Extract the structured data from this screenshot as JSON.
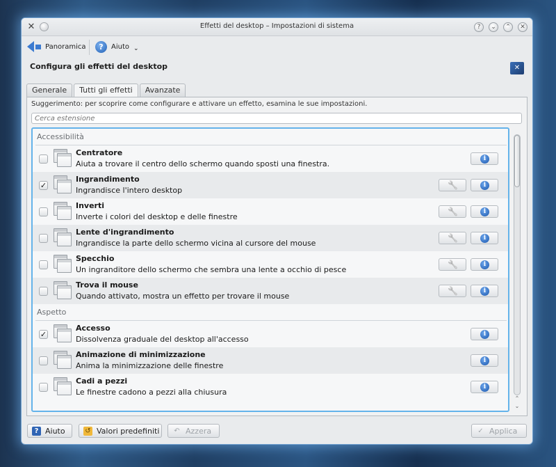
{
  "window": {
    "title": "Effetti del desktop – Impostazioni di sistema"
  },
  "toolbar": {
    "overview_label": "Panoramica",
    "help_label": "Aiuto"
  },
  "page": {
    "header": "Configura gli effetti del desktop"
  },
  "tabs": [
    {
      "label": "Generale",
      "active": false
    },
    {
      "label": "Tutti gli effetti",
      "active": true
    },
    {
      "label": "Avanzate",
      "active": false
    }
  ],
  "hint": "Suggerimento: per scoprire come configurare e attivare un effetto, esamina le sue impostazioni.",
  "search": {
    "placeholder": "Cerca estensione"
  },
  "categories": [
    {
      "name": "Accessibilità",
      "effects": [
        {
          "name": "Centratore",
          "desc": "Aiuta a trovare il centro dello schermo quando sposti una finestra.",
          "checked": false,
          "configurable": false
        },
        {
          "name": "Ingrandimento",
          "desc": "Ingrandisce l'intero desktop",
          "checked": true,
          "configurable": true
        },
        {
          "name": "Inverti",
          "desc": "Inverte i colori del desktop e delle finestre",
          "checked": false,
          "configurable": true
        },
        {
          "name": "Lente d'ingrandimento",
          "desc": "Ingrandisce la parte dello schermo vicina al cursore del mouse",
          "checked": false,
          "configurable": true
        },
        {
          "name": "Specchio",
          "desc": "Un ingranditore dello schermo che sembra una lente a occhio di pesce",
          "checked": false,
          "configurable": true
        },
        {
          "name": "Trova il mouse",
          "desc": "Quando attivato, mostra un effetto per trovare il mouse",
          "checked": false,
          "configurable": true
        }
      ]
    },
    {
      "name": "Aspetto",
      "effects": [
        {
          "name": "Accesso",
          "desc": "Dissolvenza graduale del desktop all'accesso",
          "checked": true,
          "configurable": false
        },
        {
          "name": "Animazione di minimizzazione",
          "desc": "Anima la minimizzazione delle finestre",
          "checked": false,
          "configurable": false
        },
        {
          "name": "Cadi a pezzi",
          "desc": "Le finestre cadono a pezzi alla chiusura",
          "checked": false,
          "configurable": false
        }
      ]
    }
  ],
  "bottom": {
    "help_label": "Aiuto",
    "defaults_label": "Valori predefiniti",
    "reset_label": "Azzera",
    "apply_label": "Applica"
  },
  "icons": {
    "info": "i",
    "check": "✓"
  }
}
